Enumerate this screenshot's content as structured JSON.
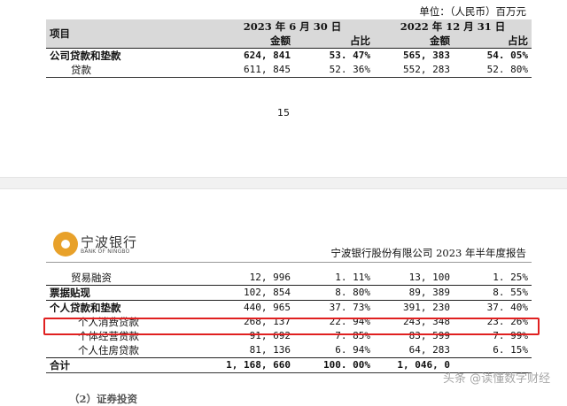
{
  "page1": {
    "unit": "单位：（人民币）百万元",
    "header": {
      "item_label": "项目",
      "period1": "2023 年 6 月 30 日",
      "period2": "2022 年 12 月 31 日",
      "amount_label": "金额",
      "share_label": "占比"
    },
    "rows": [
      {
        "label": "公司贷款和垫款",
        "a1": "624, 841",
        "s1": "53. 47%",
        "a2": "565, 383",
        "s2": "54. 05%"
      },
      {
        "label": "贷款",
        "a1": "611, 845",
        "s1": "52. 36%",
        "a2": "552, 283",
        "s2": "52. 80%"
      }
    ],
    "page_number": "15"
  },
  "page2": {
    "logo_cn": "宁波银行",
    "logo_en": "BANK OF NINGBO",
    "report_title": "宁波银行股份有限公司 2023 年半年度报告",
    "rows": [
      {
        "label": "贸易融资",
        "a1": "12, 996",
        "s1": "1. 11%",
        "a2": "13, 100",
        "s2": "1. 25%"
      },
      {
        "label": "票据贴现",
        "a1": "102, 854",
        "s1": "8. 80%",
        "a2": "89, 389",
        "s2": "8. 55%"
      },
      {
        "label": "个人贷款和垫款",
        "a1": "440, 965",
        "s1": "37. 73%",
        "a2": "391, 230",
        "s2": "37. 40%"
      },
      {
        "label": "个人消费贷款",
        "a1": "268, 137",
        "s1": "22. 94%",
        "a2": "243, 348",
        "s2": "23. 26%"
      },
      {
        "label": "个体经营贷款",
        "a1": "91, 692",
        "s1": "7. 85%",
        "a2": "83, 599",
        "s2": "7. 99%"
      },
      {
        "label": "个人住房贷款",
        "a1": "81, 136",
        "s1": "6. 94%",
        "a2": "64, 283",
        "s2": "6. 15%"
      },
      {
        "label": "合计",
        "a1": "1, 168, 660",
        "s1": "100. 00%",
        "a2": "1, 046, 0",
        "s2": ""
      }
    ],
    "next_section_partial": "（2）证券投资",
    "watermark": "头条 @读懂数字财经"
  },
  "colors": {
    "highlight": "#e02020",
    "header_bg": "#d9d9d9",
    "logo": "#e8a12a"
  }
}
